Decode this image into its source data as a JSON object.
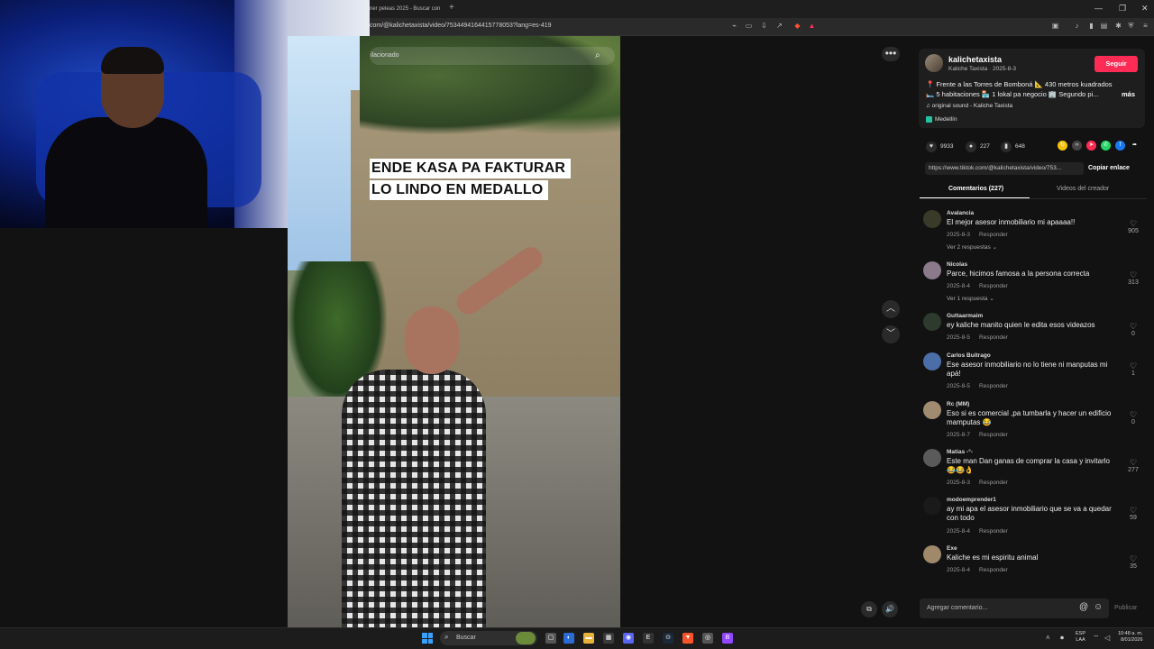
{
  "browser": {
    "tab_title": "ner peleas 2025 - Buscar con",
    "new_tab": "+",
    "window_controls": [
      "—",
      "❐",
      "✕"
    ],
    "url": "com/@kalichetaxista/video/7534494164415778053?lang=es-419"
  },
  "video": {
    "search_text": "ilacionado",
    "caption_line1": "ENDE KASA PA FAKTURAR",
    "caption_line2": "LO LINDO EN MEDALLO"
  },
  "post": {
    "author": "kalichetaxista",
    "author_sub": "Kaliche Taxista · 2025-8-3",
    "follow_label": "Seguir",
    "description_line1": "📍 Frente a las Torres de Bomboná 📐 430 metros kuadrados",
    "description_line2": "🛏️ 5 habitaciones 🏪 1 lokal pa negocio 🏢 Segundo pi...",
    "more_label": "más",
    "sound": "♫  original sound - Kaliche Taxista",
    "location": "Medellín"
  },
  "stats": {
    "likes": "9933",
    "comments": "227",
    "saves": "648"
  },
  "share": {
    "link": "https://www.tiktok.com/@kalichetaxista/video/753...",
    "copy_label": "Copiar enlace",
    "icon_colors": [
      "#f4c20d",
      "#444444",
      "#fe2c55",
      "#25d366",
      "#1877f2"
    ]
  },
  "tabs": {
    "comments": "Comentarios (227)",
    "creator_videos": "Videos del creador"
  },
  "comments": [
    {
      "user": "Avalancia",
      "text": "El mejor asesor inmobiliario mi apaaaa!!",
      "date": "2025-8-3",
      "reply": "Responder",
      "likes": "905",
      "replies": "Ver 2 respuestas ⌄"
    },
    {
      "user": "Nicolas",
      "text": "Parce, hicimos famosa a la persona correcta",
      "date": "2025-8-4",
      "reply": "Responder",
      "likes": "313",
      "replies": "Ver 1 respuesta ⌄"
    },
    {
      "user": "Guttaarmaim",
      "text": "ey kaliche manito quien le edita esos videazos",
      "date": "2025-8-5",
      "reply": "Responder",
      "likes": "0"
    },
    {
      "user": "Carlos Buitrago",
      "text": "Ese asesor inmobiliario no lo tiene ni manputas mi apá!",
      "date": "2025-8-5",
      "reply": "Responder",
      "likes": "1"
    },
    {
      "user": "Rc (MM)",
      "text": "Eso si es comercial ,pa tumbarla y hacer un edificio mamputas 😂",
      "date": "2025-8-7",
      "reply": "Responder",
      "likes": "0"
    },
    {
      "user": "Matias -°-",
      "text": "Este man Dan ganas de comprar la casa y invitarlo 😂😂👌",
      "date": "2025-8-3",
      "reply": "Responder",
      "likes": "277"
    },
    {
      "user": "modoemprender1",
      "text": "ay mi apa el asesor inmobiliario que se va a quedar con todo",
      "date": "2025-8-4",
      "reply": "Responder",
      "likes": "59"
    },
    {
      "user": "Exe",
      "text": "Kaliche es mi espiritu animal",
      "date": "2025-8-4",
      "reply": "Responder",
      "likes": "35"
    }
  ],
  "composer": {
    "placeholder": "Agregar comentario...",
    "publish": "Publicar"
  },
  "taskbar": {
    "search": "Buscar",
    "lang_line1": "ESP",
    "lang_line2": "LAA",
    "time": "10:48 a. m.",
    "date": "8/01/2026"
  }
}
